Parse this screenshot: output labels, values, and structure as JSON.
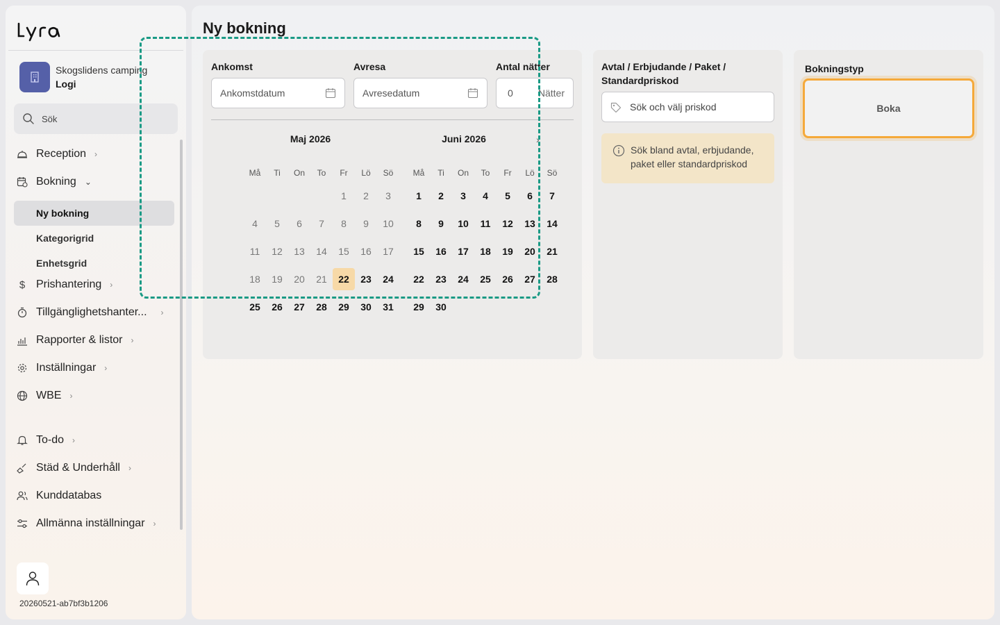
{
  "app": {
    "logo_text": "Lyra"
  },
  "org": {
    "name": "Skogslidens camping",
    "module": "Logi"
  },
  "search": {
    "placeholder": "Sök"
  },
  "nav": [
    {
      "id": "reception",
      "label": "Reception",
      "icon": "bell-service-icon",
      "chevron": "right"
    },
    {
      "id": "bokning",
      "label": "Bokning",
      "icon": "calendar-clock-icon",
      "chevron": "down"
    },
    {
      "id": "prishantering",
      "label": "Prishantering",
      "icon": "dollar-icon",
      "chevron": "right"
    },
    {
      "id": "tillganglighet",
      "label": "Tillgänglighetshanter...",
      "icon": "timer-icon",
      "chevron": "right"
    },
    {
      "id": "rapporter",
      "label": "Rapporter & listor",
      "icon": "chart-icon",
      "chevron": "right"
    },
    {
      "id": "installningar",
      "label": "Inställningar",
      "icon": "gear-icon",
      "chevron": "right"
    },
    {
      "id": "wbe",
      "label": "WBE",
      "icon": "globe-icon",
      "chevron": "right"
    },
    {
      "id": "todo",
      "label": "To-do",
      "icon": "bell-icon",
      "chevron": "right"
    },
    {
      "id": "stad",
      "label": "Städ & Underhåll",
      "icon": "broom-icon",
      "chevron": "right"
    },
    {
      "id": "kunddatabas",
      "label": "Kunddatabas",
      "icon": "users-icon",
      "chevron": ""
    },
    {
      "id": "allmanna",
      "label": "Allmänna inställningar",
      "icon": "sliders-icon",
      "chevron": "right"
    }
  ],
  "subnav": [
    {
      "label": "Ny bokning",
      "active": true
    },
    {
      "label": "Kategorigrid",
      "active": false
    },
    {
      "label": "Enhetsgrid",
      "active": false
    }
  ],
  "build_id": "20260521-ab7bf3b1206",
  "page": {
    "title": "Ny bokning"
  },
  "dates": {
    "arrival_label": "Ankomst",
    "arrival_placeholder": "Ankomstdatum",
    "departure_label": "Avresa",
    "departure_placeholder": "Avresedatum",
    "nights_label": "Antal nätter",
    "nights_value": "0",
    "nights_unit": "Nätter"
  },
  "calendar": {
    "weekdays": [
      "Må",
      "Ti",
      "On",
      "To",
      "Fr",
      "Lö",
      "Sö"
    ],
    "months": [
      {
        "title": "Maj 2026",
        "offset": 4,
        "days": 31,
        "today": 22
      },
      {
        "title": "Juni 2026",
        "offset": 0,
        "days": 30,
        "today": 0
      }
    ],
    "next_icon": "chevron-right-icon"
  },
  "promo": {
    "label": "Avtal / Erbjudande / Paket / Standardpriskod",
    "placeholder": "Sök och välj priskod",
    "info": "Sök bland avtal, erbjudande, paket eller standardpriskod"
  },
  "booking_type": {
    "label": "Bokningstyp",
    "button": "Boka"
  },
  "colors": {
    "accent_orange": "#f5a93a",
    "brand": "#5560a8",
    "today": "#f7d9a7",
    "info_bg": "#f3e5c8"
  }
}
